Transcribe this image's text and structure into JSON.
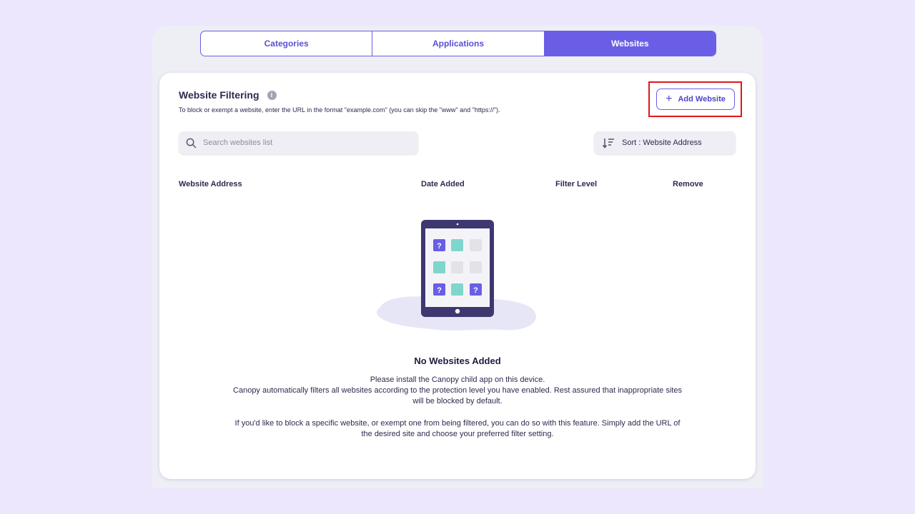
{
  "tabs": [
    {
      "label": "Categories",
      "active": false
    },
    {
      "label": "Applications",
      "active": false
    },
    {
      "label": "Websites",
      "active": true
    }
  ],
  "card": {
    "title": "Website Filtering",
    "info_icon": "info-icon",
    "subtitle": "To block or exempt a website, enter the URL in the format \"example.com\" (you can skip the \"www\" and \"https://\").",
    "add_button": {
      "plus": "+",
      "label": "Add Website"
    }
  },
  "search": {
    "placeholder": "Search websites list",
    "value": "",
    "icon": "search-icon"
  },
  "sort": {
    "label": "Sort : Website Address",
    "icon": "sort-icon"
  },
  "table": {
    "columns": [
      "Website Address",
      "Date Added",
      "Filter Level",
      "Remove"
    ]
  },
  "empty_state": {
    "illustration": "tablet-illustration",
    "question_mark": "?",
    "title": "No Websites Added",
    "message_1": "Please install the Canopy child app on this device.\nCanopy automatically filters all websites according to the protection level you have enabled. Rest assured that inappropriate sites will be blocked by default.",
    "message_2": "If you'd like to block a specific website, or exempt one from being filtered, you can do so with this feature. Simply add the URL of the desired site and choose your preferred filter setting."
  },
  "colors": {
    "accent": "#6a5ee6",
    "page_bg": "#ede7fd",
    "highlight": "#e01818",
    "tile_teal": "#7fd6cc",
    "tablet_dark": "#3d3870"
  }
}
